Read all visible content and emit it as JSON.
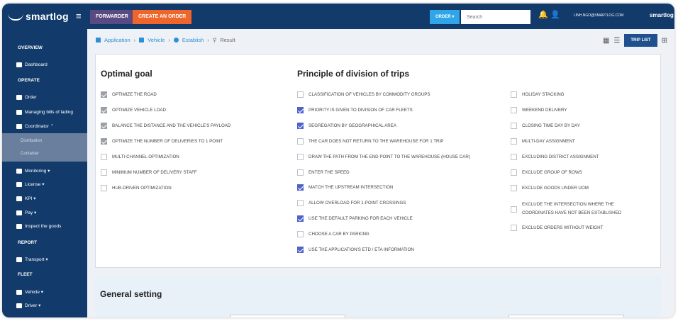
{
  "topbar": {
    "logo": "smartlog",
    "forwarder_label": "FORWARDER",
    "create_order_label": "CREATE AN ORDER",
    "order_select": "ORDER ▾",
    "search_placeholder": "Search",
    "user_email": "LINH.NGO@SMARTLOG.COM",
    "brand": "smartlog"
  },
  "sidebar": {
    "sections": [
      "OVERVIEW",
      "OPERATE",
      "REPORT",
      "FLEET"
    ],
    "items": [
      {
        "label": "Dashboard",
        "icon": "dashboard-icon"
      },
      {
        "label": "Order",
        "icon": "order-icon"
      },
      {
        "label": "Managing bills of lading",
        "icon": "bill-icon"
      },
      {
        "label": "Coordinator ⌃",
        "icon": "coordinator-icon"
      },
      {
        "label": "Monitoring ▾",
        "icon": "monitoring-icon"
      },
      {
        "label": "License ▾",
        "icon": "license-icon"
      },
      {
        "label": "KPI ▾",
        "icon": "kpi-icon"
      },
      {
        "label": "Pay ▾",
        "icon": "pay-icon"
      },
      {
        "label": "Inspect the goods",
        "icon": "inspect-icon"
      },
      {
        "label": "Transport ▾",
        "icon": "transport-icon"
      },
      {
        "label": "Vehicle ▾",
        "icon": "vehicle-icon"
      },
      {
        "label": "Driver ▾",
        "icon": "driver-icon"
      }
    ],
    "sub_items": [
      "Distribution",
      "Container"
    ]
  },
  "breadcrumb": [
    "Application",
    "Vehicle",
    "Establish",
    "Result"
  ],
  "toolbar": {
    "trip_list_label": "TRIP LIST"
  },
  "optimal_goal": {
    "title": "Optimal goal",
    "options": [
      {
        "label": "OPTIMIZE THE ROAD",
        "state": "grey"
      },
      {
        "label": "OPTIMIZE VEHICLE LOAD",
        "state": "grey"
      },
      {
        "label": "BALANCE THE DISTANCE AND THE VEHICLE'S PAYLOAD",
        "state": "grey"
      },
      {
        "label": "OPTIMIZE THE NUMBER OF DELIVERIES TO 1 POINT",
        "state": "grey"
      },
      {
        "label": "MULTI-CHANNEL OPTIMIZATION",
        "state": "off"
      },
      {
        "label": "MINIMUM NUMBER OF DELIVERY STAFF",
        "state": "off"
      },
      {
        "label": "HUB-DRIVEN OPTIMIZATION",
        "state": "off"
      }
    ]
  },
  "division": {
    "title": "Principle of division of trips",
    "col1": [
      {
        "label": "CLASSIFICATION OF VEHICLES BY COMMODITY GROUPS",
        "state": "off"
      },
      {
        "label": "PRIORITY IS GIVEN TO DIVISION OF CAR FLEETS",
        "state": "on"
      },
      {
        "label": "SEGREGATION BY GEOGRAPHICAL AREA",
        "state": "on"
      },
      {
        "label": "THE CAR DOES NOT RETURN TO THE WAREHOUSE FOR 1 TRIP",
        "state": "off"
      },
      {
        "label": "DRAW THE PATH FROM THE END POINT TO THE WAREHOUSE (HOUSE CAR)",
        "state": "off"
      },
      {
        "label": "ENTER THE SPEED",
        "state": "off"
      },
      {
        "label": "MATCH THE UPSTREAM INTERSECTION",
        "state": "on"
      },
      {
        "label": "ALLOW OVERLOAD FOR 1-POINT CROSSINGS",
        "state": "off"
      },
      {
        "label": "USE THE DEFAULT PARKING FOR EACH VEHICLE",
        "state": "on"
      },
      {
        "label": "CHOOSE A CAR BY PARKING",
        "state": "off"
      },
      {
        "label": "USE THE APPLICATION'S ETD / ETA INFORMATION",
        "state": "on"
      }
    ],
    "col2": [
      {
        "label": "HOLIDAY STACKING",
        "state": "off"
      },
      {
        "label": "WEEKEND DELIVERY",
        "state": "off"
      },
      {
        "label": "CLOSING TIME DAY BY DAY",
        "state": "off"
      },
      {
        "label": "MULTI-DAY ASSIGNMENT",
        "state": "off"
      },
      {
        "label": "EXCLUDING DISTRICT ASSIGNMENT",
        "state": "off"
      },
      {
        "label": "EXCLUDE GROUP OF ROWS",
        "state": "off"
      },
      {
        "label": "EXCLUDE GOODS UNDER UOM",
        "state": "off"
      },
      {
        "label": "EXCLUDE THE INTERSECTION WHERE THE",
        "label2": "COORDINATES HAVE NOT BEEN ESTABLISHED",
        "state": "off"
      },
      {
        "label": "EXCLUDE ORDERS WITHOUT WEIGHT",
        "state": "off"
      }
    ]
  },
  "general": {
    "title": "General setting"
  },
  "colors": {
    "navy": "#123a6b",
    "orange": "#f0662a",
    "purple": "#5a4a82",
    "accent": "#4f63c9",
    "link": "#2e8fd6"
  }
}
